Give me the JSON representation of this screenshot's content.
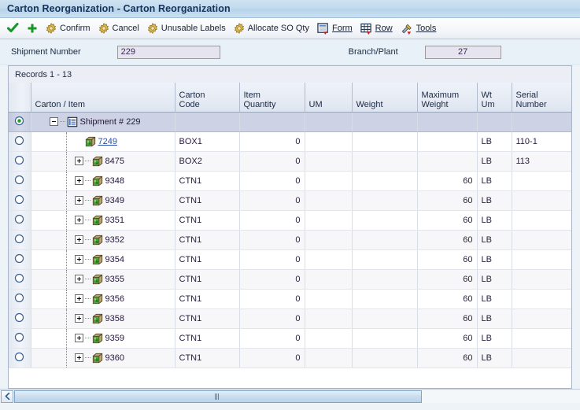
{
  "window": {
    "title": "Carton Reorganization - Carton Reorganization"
  },
  "toolbar": {
    "items": [
      {
        "label": "",
        "icon": "check-icon"
      },
      {
        "label": "",
        "icon": "plus-icon"
      },
      {
        "label": "Confirm",
        "icon": "gear-icon"
      },
      {
        "label": "Cancel",
        "icon": "gear-icon"
      },
      {
        "label": "Unusable Labels",
        "icon": "gear-icon"
      },
      {
        "label": "Allocate SO Qty",
        "icon": "gear-icon"
      },
      {
        "label": "Form",
        "icon": "form-icon"
      },
      {
        "label": "Row",
        "icon": "row-icon"
      },
      {
        "label": "Tools",
        "icon": "tools-icon"
      }
    ]
  },
  "fields": {
    "shipment_label": "Shipment Number",
    "shipment_value": "229",
    "branch_label": "Branch/Plant",
    "branch_value": "27"
  },
  "grid": {
    "records_text": "Records 1 - 13",
    "columns": [
      {
        "name": "selector",
        "label": ""
      },
      {
        "name": "carton-item",
        "label": "Carton / Item"
      },
      {
        "name": "carton-code",
        "label": "Carton\nCode"
      },
      {
        "name": "item-quantity",
        "label": "Item\nQuantity"
      },
      {
        "name": "um",
        "label": "UM"
      },
      {
        "name": "weight",
        "label": "Weight"
      },
      {
        "name": "maximum-weight",
        "label": "Maximum\nWeight"
      },
      {
        "name": "wt-um",
        "label": "Wt\nUm"
      },
      {
        "name": "serial-number",
        "label": "Serial\nNumber"
      }
    ],
    "column_labels": {
      "carton_item": "Carton / Item",
      "carton_code_l1": "Carton",
      "carton_code_l2": "Code",
      "item_qty_l1": "Item",
      "item_qty_l2": "Quantity",
      "um": "UM",
      "weight": "Weight",
      "max_weight_l1": "Maximum",
      "max_weight_l2": "Weight",
      "wt_um_l1": "Wt",
      "wt_um_l2": "Um",
      "serial_l1": "Serial",
      "serial_l2": "Number"
    },
    "rows": [
      {
        "type": "root",
        "selected": true,
        "expander": "minus",
        "icon": "document-list-icon",
        "carton_item": "Shipment # 229",
        "link": false,
        "carton_code": "",
        "item_quantity": "",
        "um": "",
        "weight": "",
        "maximum_weight": "",
        "wt_um": "",
        "serial_number": ""
      },
      {
        "type": "child",
        "selected": false,
        "expander": "none",
        "icon": "carton-icon",
        "carton_item": "7249",
        "link": true,
        "carton_code": "BOX1",
        "item_quantity": "0",
        "um": "",
        "weight": "",
        "maximum_weight": "",
        "wt_um": "LB",
        "serial_number": "110-1"
      },
      {
        "type": "child",
        "selected": false,
        "expander": "plus",
        "icon": "carton-icon",
        "carton_item": "8475",
        "link": false,
        "carton_code": "BOX2",
        "item_quantity": "0",
        "um": "",
        "weight": "",
        "maximum_weight": "",
        "wt_um": "LB",
        "serial_number": "113"
      },
      {
        "type": "child",
        "selected": false,
        "expander": "plus",
        "icon": "carton-icon",
        "carton_item": "9348",
        "link": false,
        "carton_code": "CTN1",
        "item_quantity": "0",
        "um": "",
        "weight": "",
        "maximum_weight": "60",
        "wt_um": "LB",
        "serial_number": ""
      },
      {
        "type": "child",
        "selected": false,
        "expander": "plus",
        "icon": "carton-icon",
        "carton_item": "9349",
        "link": false,
        "carton_code": "CTN1",
        "item_quantity": "0",
        "um": "",
        "weight": "",
        "maximum_weight": "60",
        "wt_um": "LB",
        "serial_number": ""
      },
      {
        "type": "child",
        "selected": false,
        "expander": "plus",
        "icon": "carton-icon",
        "carton_item": "9351",
        "link": false,
        "carton_code": "CTN1",
        "item_quantity": "0",
        "um": "",
        "weight": "",
        "maximum_weight": "60",
        "wt_um": "LB",
        "serial_number": ""
      },
      {
        "type": "child",
        "selected": false,
        "expander": "plus",
        "icon": "carton-icon",
        "carton_item": "9352",
        "link": false,
        "carton_code": "CTN1",
        "item_quantity": "0",
        "um": "",
        "weight": "",
        "maximum_weight": "60",
        "wt_um": "LB",
        "serial_number": ""
      },
      {
        "type": "child",
        "selected": false,
        "expander": "plus",
        "icon": "carton-icon",
        "carton_item": "9354",
        "link": false,
        "carton_code": "CTN1",
        "item_quantity": "0",
        "um": "",
        "weight": "",
        "maximum_weight": "60",
        "wt_um": "LB",
        "serial_number": ""
      },
      {
        "type": "child",
        "selected": false,
        "expander": "plus",
        "icon": "carton-icon",
        "carton_item": "9355",
        "link": false,
        "carton_code": "CTN1",
        "item_quantity": "0",
        "um": "",
        "weight": "",
        "maximum_weight": "60",
        "wt_um": "LB",
        "serial_number": ""
      },
      {
        "type": "child",
        "selected": false,
        "expander": "plus",
        "icon": "carton-icon",
        "carton_item": "9356",
        "link": false,
        "carton_code": "CTN1",
        "item_quantity": "0",
        "um": "",
        "weight": "",
        "maximum_weight": "60",
        "wt_um": "LB",
        "serial_number": ""
      },
      {
        "type": "child",
        "selected": false,
        "expander": "plus",
        "icon": "carton-icon",
        "carton_item": "9358",
        "link": false,
        "carton_code": "CTN1",
        "item_quantity": "0",
        "um": "",
        "weight": "",
        "maximum_weight": "60",
        "wt_um": "LB",
        "serial_number": ""
      },
      {
        "type": "child",
        "selected": false,
        "expander": "plus",
        "icon": "carton-icon",
        "carton_item": "9359",
        "link": false,
        "carton_code": "CTN1",
        "item_quantity": "0",
        "um": "",
        "weight": "",
        "maximum_weight": "60",
        "wt_um": "LB",
        "serial_number": ""
      },
      {
        "type": "child",
        "selected": false,
        "expander": "plus",
        "icon": "carton-icon",
        "carton_item": "9360",
        "link": false,
        "carton_code": "CTN1",
        "item_quantity": "0",
        "um": "",
        "weight": "",
        "maximum_weight": "60",
        "wt_um": "LB",
        "serial_number": ""
      }
    ]
  },
  "colors": {
    "title_text": "#16335c",
    "title_bar": "#c2dbee",
    "link": "#2a4fa8",
    "root_row": "#cdd2e4",
    "accent_green": "#1e8a28"
  }
}
